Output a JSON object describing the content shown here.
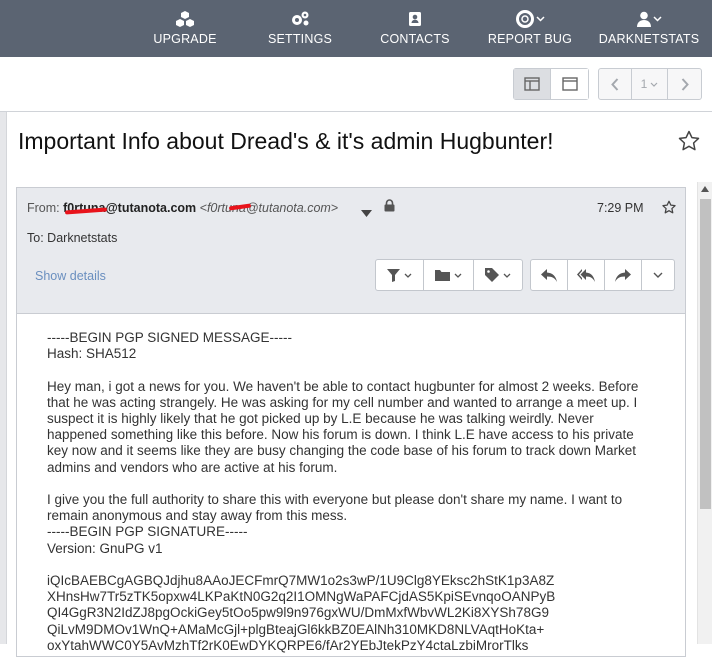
{
  "topnav": {
    "items": [
      {
        "label": "UPGRADE",
        "icon": "cubes-icon"
      },
      {
        "label": "SETTINGS",
        "icon": "gears-icon"
      },
      {
        "label": "CONTACTS",
        "icon": "contact-card-icon"
      },
      {
        "label": "REPORT BUG",
        "icon": "lifebuoy-icon"
      },
      {
        "label": "DARKNETSTATS",
        "icon": "user-icon"
      }
    ]
  },
  "toolbar": {
    "page_selector": "1"
  },
  "subject": "Important Info about Dread's & it's admin Hugbunter!",
  "header": {
    "from_label": "From:",
    "from_name": "f0rtuna@tutanota.com",
    "from_address": "<f0rtuna@tutanota.com>",
    "to_label": "To:",
    "to_value": "Darknetstats",
    "time": "7:29 PM",
    "show_details": "Show details"
  },
  "body": {
    "text": "-----BEGIN PGP SIGNED MESSAGE-----\nHash: SHA512\n\nHey man, i got a news for you. We haven't be able to contact hugbunter for almost 2 weeks. Before that he was acting strangely. He was asking for my cell number and wanted to arrange a meet up. I suspect it is highly likely that he got picked up by L.E because he was talking weirdly. Never happened something like this before. Now his forum is down. I think L.E have access to his private key now and it seems like they are busy changing the code base of his forum to track down Market admins and vendors who are active at his forum.\n\nI give you the full authority to share this with everyone but please don't share my name. I want to remain anonymous and stay away from this mess.\n-----BEGIN PGP SIGNATURE-----\nVersion: GnuPG v1\n\niQIcBAEBCgAGBQJdjhu8AAoJECFmrQ7MW1o2s3wP/1U9Clg8YEksc2hStK1p3A8Z\nXHnsHw7Tr5zTK5opxw4LKPaKtN0G2q2I1OMNgWaPAFCjdAS5KpiSEvnqoOANPyB\nQI4GgR3N2IdZJ8pgOckiGey5tOo5pw9l9n976gxWU/DmMxfWbvWL2Ki8XYSh78G9\nQiLvM9DMOv1WnQ+AMaMcGjl+plgBteajGl6kkBZ0EAlNh310MKD8NLVAqtHoKta+\noxYtahWWC0Y5AvMzhTf2rK0EwDYKQRPE6/fAr2YEbJtekPzY4ctaLzbiMrorTlks"
  },
  "colors": {
    "topbar": "#5b6472",
    "link": "#6a8fbf",
    "redaction": "#e8131b"
  }
}
